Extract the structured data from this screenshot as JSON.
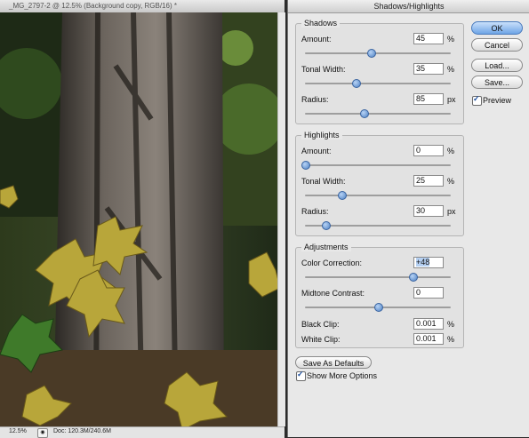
{
  "document": {
    "title": "_MG_2797-2 @ 12.5% (Background copy, RGB/16) *",
    "zoom": "12.5%",
    "doc_size": "Doc: 120.3M/240.6M"
  },
  "dialog": {
    "title": "Shadows/Highlights",
    "buttons": {
      "ok": "OK",
      "cancel": "Cancel",
      "load": "Load...",
      "save": "Save..."
    },
    "preview": {
      "label": "Preview",
      "checked": true
    },
    "shadows": {
      "label": "Shadows",
      "amount": {
        "label": "Amount:",
        "value": "45",
        "unit": "%",
        "level": 0.45
      },
      "tonal_width": {
        "label": "Tonal Width:",
        "value": "35",
        "unit": "%",
        "level": 0.35
      },
      "radius": {
        "label": "Radius:",
        "value": "85",
        "unit": "px",
        "level": 0.4
      }
    },
    "highlights": {
      "label": "Highlights",
      "amount": {
        "label": "Amount:",
        "value": "0",
        "unit": "%",
        "level": 0.0
      },
      "tonal_width": {
        "label": "Tonal Width:",
        "value": "25",
        "unit": "%",
        "level": 0.25
      },
      "radius": {
        "label": "Radius:",
        "value": "30",
        "unit": "px",
        "level": 0.14
      }
    },
    "adjustments": {
      "label": "Adjustments",
      "color_correction": {
        "label": "Color Correction:",
        "value": "+48",
        "level": 0.74
      },
      "midtone_contrast": {
        "label": "Midtone Contrast:",
        "value": "0",
        "level": 0.5
      },
      "black_clip": {
        "label": "Black Clip:",
        "value": "0.001",
        "unit": "%"
      },
      "white_clip": {
        "label": "White Clip:",
        "value": "0.001",
        "unit": "%"
      }
    },
    "save_defaults": "Save As Defaults",
    "show_more": {
      "label": "Show More Options",
      "checked": true
    }
  }
}
